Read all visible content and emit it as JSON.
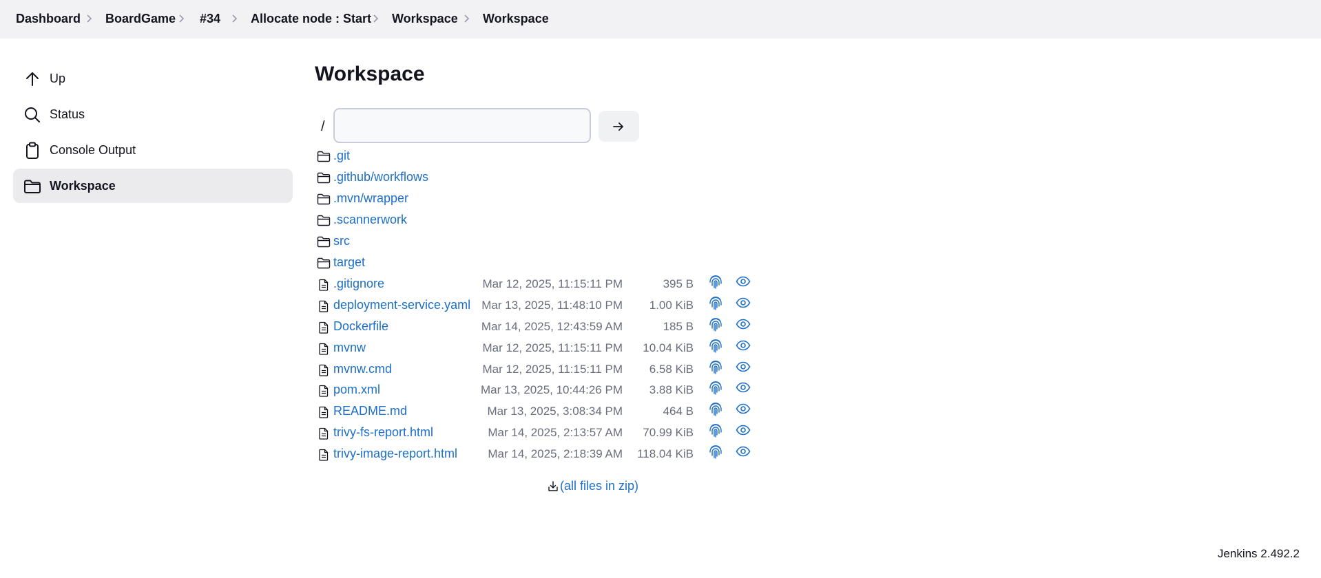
{
  "breadcrumb": [
    "Dashboard",
    "BoardGame",
    "#34",
    "Allocate node : Start",
    "Workspace",
    "Workspace"
  ],
  "sidebar": {
    "items": [
      {
        "label": "Up",
        "icon": "arrow-up-icon"
      },
      {
        "label": "Status",
        "icon": "search-icon"
      },
      {
        "label": "Console Output",
        "icon": "clipboard-icon"
      },
      {
        "label": "Workspace",
        "icon": "folder-icon",
        "active": true
      }
    ]
  },
  "main": {
    "title": "Workspace",
    "path_prefix": "/",
    "path_value": "",
    "go_icon": "arrow-right-icon",
    "folders": [
      ".git",
      ".github/workflows",
      ".mvn/wrapper",
      ".scannerwork",
      "src",
      "target"
    ],
    "files": [
      {
        "name": ".gitignore",
        "date": "Mar 12, 2025, 11:15:11 PM",
        "size": "395 B"
      },
      {
        "name": "deployment-service.yaml",
        "date": "Mar 13, 2025, 11:48:10 PM",
        "size": "1.00 KiB"
      },
      {
        "name": "Dockerfile",
        "date": "Mar 14, 2025, 12:43:59 AM",
        "size": "185 B"
      },
      {
        "name": "mvnw",
        "date": "Mar 12, 2025, 11:15:11 PM",
        "size": "10.04 KiB"
      },
      {
        "name": "mvnw.cmd",
        "date": "Mar 12, 2025, 11:15:11 PM",
        "size": "6.58 KiB"
      },
      {
        "name": "pom.xml",
        "date": "Mar 13, 2025, 10:44:26 PM",
        "size": "3.88 KiB"
      },
      {
        "name": "README.md",
        "date": "Mar 13, 2025, 3:08:34 PM",
        "size": "464 B"
      },
      {
        "name": "trivy-fs-report.html",
        "date": "Mar 14, 2025, 2:13:57 AM",
        "size": "70.99 KiB"
      },
      {
        "name": "trivy-image-report.html",
        "date": "Mar 14, 2025, 2:18:39 AM",
        "size": "118.04 KiB"
      }
    ],
    "zip_label": "(all files in zip)"
  },
  "footer": {
    "version": "Jenkins 2.492.2"
  },
  "colors": {
    "link": "#1d6fc8",
    "muted": "#6a6d7d",
    "topbar": "#f2f2f4",
    "active_bg": "#ebebee"
  }
}
